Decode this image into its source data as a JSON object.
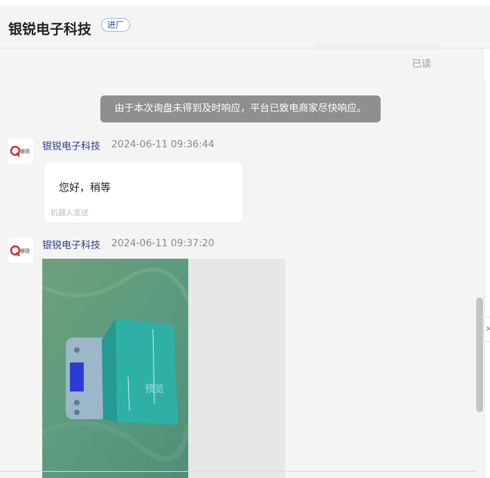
{
  "header": {
    "shop_name": "银锐电子科技",
    "shop_tag": "进厂"
  },
  "chat": {
    "read_status": "已读",
    "system_notice": "由于本次询盘未得到及时响应，平台已致电商家尽快响应。",
    "messages": [
      {
        "sender": "银锐电子科技",
        "time": "2024-06-11 09:36:44",
        "text": "您好，稍等",
        "note": "机器人发送"
      },
      {
        "sender": "银锐电子科技",
        "time": "2024-06-11 09:37:20",
        "image_overlay": "预览"
      }
    ]
  },
  "avatar_logo_text": "银锐",
  "colors": {
    "sender_name": "#2c3e8f",
    "notice_bg": "#8f8f8f",
    "logo_red": "#d6252b"
  }
}
